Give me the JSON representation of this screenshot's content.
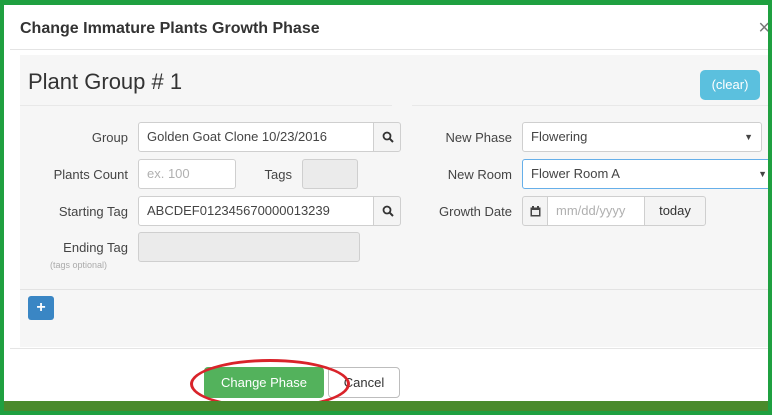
{
  "modal": {
    "title": "Change Immature Plants Growth Phase",
    "close": "×"
  },
  "group": {
    "heading": "Plant Group # 1",
    "clear_label": "(clear)",
    "group_label": "Group",
    "group_value": "Golden Goat Clone 10/23/2016",
    "plants_count_label": "Plants Count",
    "plants_count_placeholder": "ex. 100",
    "tags_label": "Tags",
    "starting_tag_label": "Starting Tag",
    "starting_tag_value": "ABCDEF012345670000013239",
    "ending_tag_label": "Ending Tag",
    "ending_tag_hint": "(tags optional)",
    "new_phase_label": "New Phase",
    "new_phase_value": "Flowering",
    "new_room_label": "New Room",
    "new_room_value": "Flower Room A",
    "growth_date_label": "Growth Date",
    "growth_date_placeholder": "mm/dd/yyyy",
    "today_label": "today",
    "add_label": "+"
  },
  "footer": {
    "change_phase_label": "Change Phase",
    "cancel_label": "Cancel"
  },
  "icons": {
    "search": "search-icon",
    "calendar": "calendar-icon",
    "dropdown": "caret-down-icon"
  },
  "colors": {
    "frame": "#1fa040",
    "clear_button": "#5bc0de",
    "add_button": "#3a86c4",
    "change_button": "#53b25c",
    "highlight": "#d9232a"
  }
}
